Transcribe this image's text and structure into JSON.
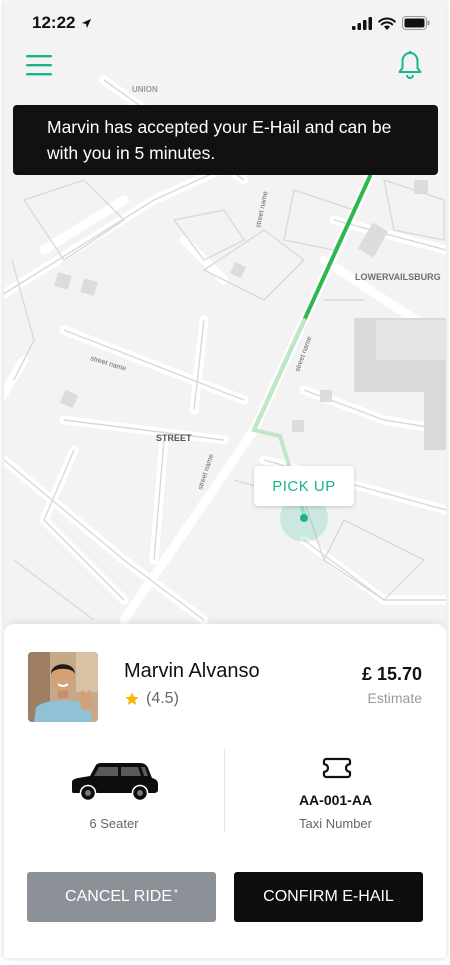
{
  "status_bar": {
    "time": "12:22"
  },
  "banner": {
    "message": "Marvin has accepted your E-Hail and can be with you in 5 minutes."
  },
  "map": {
    "labels": {
      "union": "UNION",
      "lowervailsburg": "LOWERVAILSBURG",
      "street": "STREET",
      "street_name": "street name"
    },
    "pickup_label": "PICK UP",
    "route_color": "#2db84d",
    "accent_color": "#19b38d"
  },
  "driver": {
    "name": "Marvin Alvanso",
    "rating": "(4.5)",
    "price": "£ 15.70",
    "price_label": "Estimate"
  },
  "vehicle": {
    "seats_label": "6 Seater"
  },
  "taxi": {
    "number": "AA-001-AA",
    "number_label": "Taxi Number"
  },
  "actions": {
    "cancel_label": "CANCEL RIDE",
    "cancel_mark": "*",
    "confirm_label": "CONFIRM E-HAIL"
  }
}
